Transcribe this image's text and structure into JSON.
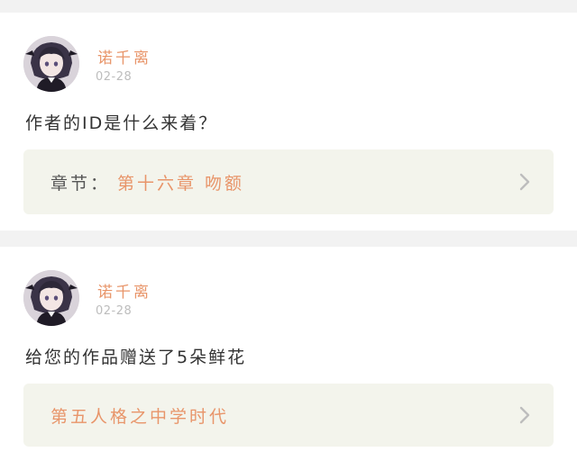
{
  "comments": [
    {
      "avatar_icon": "anime-girl-avatar-icon",
      "username": "诺千离",
      "date": "02-28",
      "message": "作者的ID是什么来着？",
      "link_prefix": "章节：",
      "link_text": "第十六章  吻额",
      "chevron_icon": "chevron-right-icon"
    },
    {
      "avatar_icon": "anime-girl-avatar-icon",
      "username": "诺千离",
      "date": "02-28",
      "message": "给您的作品赠送了5朵鲜花",
      "link_prefix": "",
      "link_text": "第五人格之中学时代",
      "chevron_icon": "chevron-right-icon"
    }
  ],
  "colors": {
    "accent": "#e8956a",
    "card_background": "#ffffff",
    "link_box_background": "#f3f4ec",
    "page_background": "#f2f2f2"
  }
}
